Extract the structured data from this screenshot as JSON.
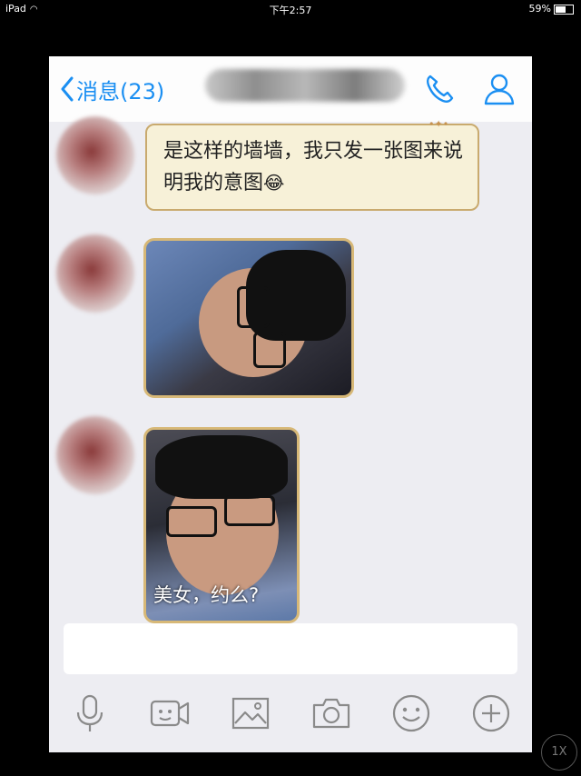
{
  "status_bar": {
    "device": "iPad",
    "time": "下午2:57",
    "battery": "59%"
  },
  "nav": {
    "back_label": "消息(23)",
    "icons": [
      "phone-icon",
      "contact-icon"
    ],
    "accent_color": "#1b8ff2"
  },
  "messages": [
    {
      "type": "text",
      "text": "是这样的墙墙，我只发一张图来说明我的意图",
      "emoji": "😂"
    },
    {
      "type": "image",
      "subject": "photo"
    },
    {
      "type": "image",
      "subject": "photo",
      "caption": "美女，约么?"
    }
  ],
  "input": {
    "value": ""
  },
  "toolbar": {
    "icons": [
      "microphone-icon",
      "video-icon",
      "image-icon",
      "camera-icon",
      "emoji-icon",
      "plus-icon"
    ]
  },
  "overlay": {
    "zoom_label": "1X"
  }
}
